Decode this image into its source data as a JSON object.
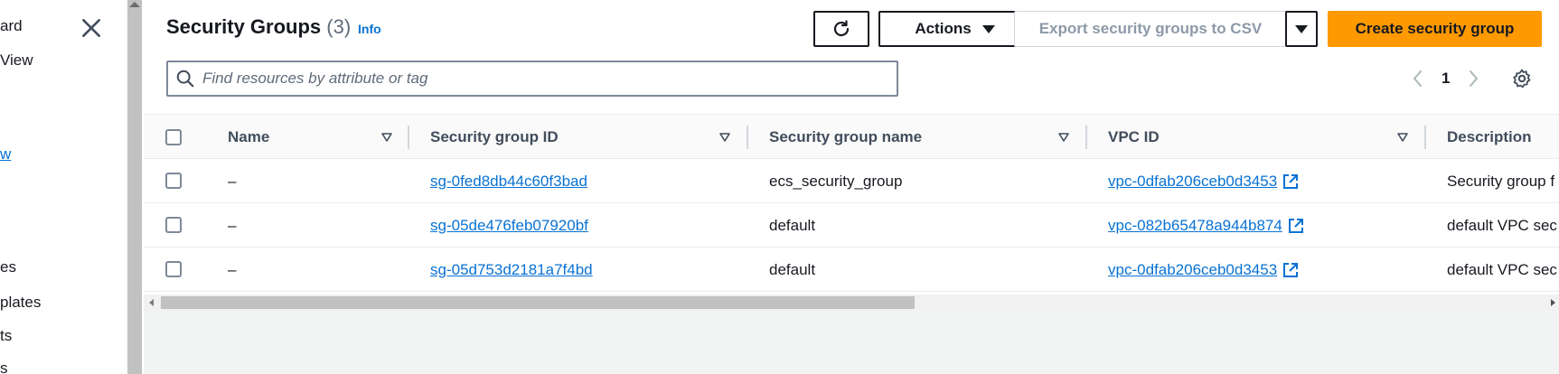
{
  "sidebar": {
    "items": [
      {
        "label": "ard"
      },
      {
        "label": "View"
      },
      {
        "label": "w"
      },
      {
        "label": "es"
      },
      {
        "label": "plates"
      },
      {
        "label": "ts"
      },
      {
        "label": "s"
      }
    ],
    "close_icon": "close-icon"
  },
  "header": {
    "title": "Security Groups",
    "count": "(3)",
    "info": "Info",
    "actions_label": "Actions",
    "export_label": "Export security groups to CSV",
    "create_label": "Create security group",
    "refresh_icon": "refresh-icon"
  },
  "search": {
    "placeholder": "Find resources by attribute or tag"
  },
  "pagination": {
    "current_page": "1"
  },
  "table": {
    "columns": [
      {
        "label": "Name"
      },
      {
        "label": "Security group ID"
      },
      {
        "label": "Security group name"
      },
      {
        "label": "VPC ID"
      },
      {
        "label": "Description"
      }
    ],
    "rows": [
      {
        "name": "–",
        "sg_id": "sg-0fed8db44c60f3bad",
        "sg_name": "ecs_security_group",
        "vpc_id": "vpc-0dfab206ceb0d3453",
        "description": "Security group f"
      },
      {
        "name": "–",
        "sg_id": "sg-05de476feb07920bf",
        "sg_name": "default",
        "vpc_id": "vpc-082b65478a944b874",
        "description": "default VPC sec"
      },
      {
        "name": "–",
        "sg_id": "sg-05d753d2181a7f4bd",
        "sg_name": "default",
        "vpc_id": "vpc-0dfab206ceb0d3453",
        "description": "default VPC sec"
      }
    ]
  },
  "colors": {
    "primary": "#ff9900",
    "link": "#0972d3",
    "text": "#16191f"
  }
}
